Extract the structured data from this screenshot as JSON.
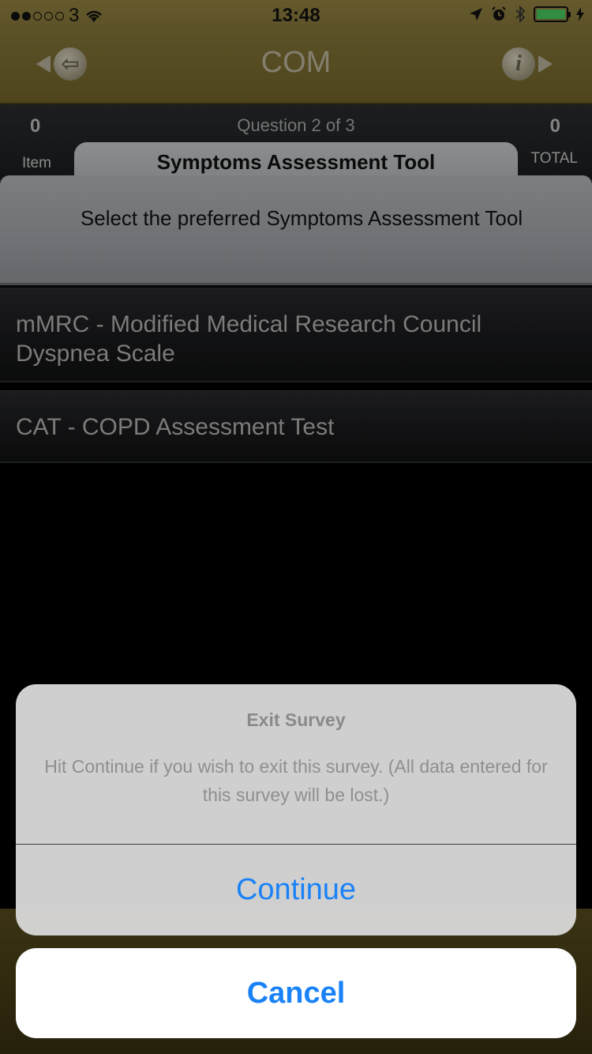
{
  "status": {
    "carrier": "3",
    "time": "13:48",
    "signal_filled": 2,
    "signal_total": 5,
    "battery_color": "#4cd964"
  },
  "nav": {
    "title": "COM",
    "back_icon": "back-arrow-icon",
    "info_icon": "info-icon",
    "info_glyph": "i",
    "back_glyph": "⇦"
  },
  "question": {
    "item_count": "0",
    "item_label": "Item",
    "progress": "Question 2 of 3",
    "total_count": "0",
    "total_label": "TOTAL",
    "title": "Symptoms Assessment Tool",
    "text": "Select the preferred Symptoms Assessment Tool"
  },
  "options": [
    {
      "label": "mMRC - Modified Medical Research Council Dyspnea Scale"
    },
    {
      "label": "CAT - COPD Assessment Test"
    }
  ],
  "alert": {
    "title": "Exit Survey",
    "message": "Hit Continue if you wish to exit this survey. (All data entered for this survey will be lost.)",
    "continue_label": "Continue",
    "cancel_label": "Cancel",
    "accent_color": "#1a82f7"
  }
}
